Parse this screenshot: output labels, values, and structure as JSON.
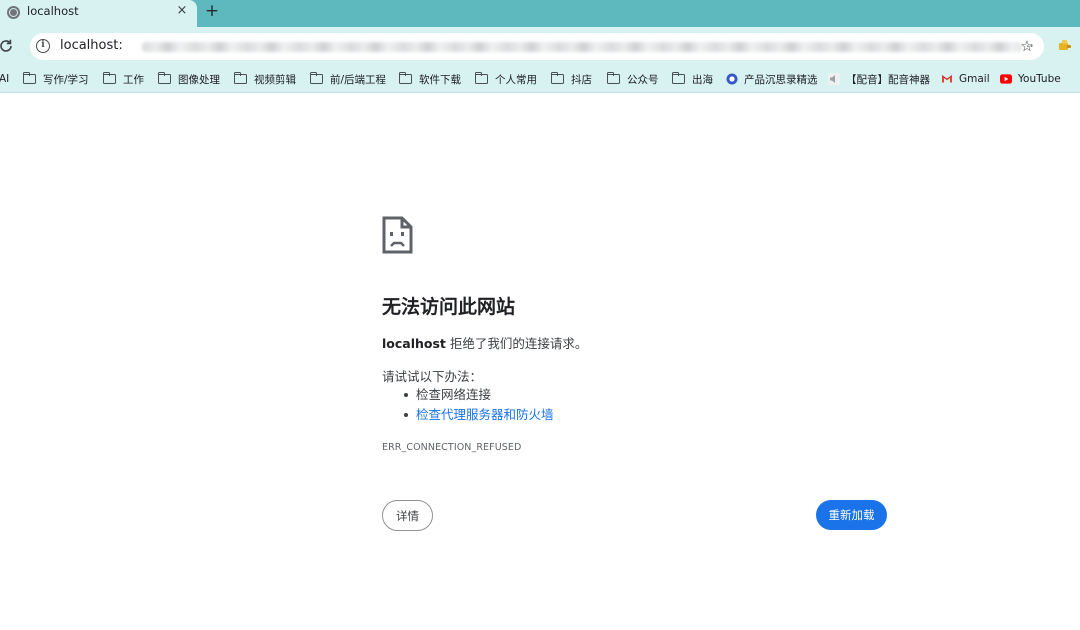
{
  "tab": {
    "title": "localhost",
    "close_glyph": "×",
    "new_tab_glyph": "+"
  },
  "toolbar": {
    "url": "localhost:",
    "url_ellipsis": "..",
    "star_glyph": "☆"
  },
  "bookmarks": {
    "first_item": "AI",
    "items": [
      {
        "label": "写作/学习",
        "icon": "folder-icon"
      },
      {
        "label": "工作",
        "icon": "folder-icon"
      },
      {
        "label": "图像处理",
        "icon": "folder-icon"
      },
      {
        "label": "视频剪辑",
        "icon": "folder-icon"
      },
      {
        "label": "前/后端工程",
        "icon": "folder-icon"
      },
      {
        "label": "软件下载",
        "icon": "folder-icon"
      },
      {
        "label": "个人常用",
        "icon": "folder-icon"
      },
      {
        "label": "抖店",
        "icon": "folder-icon"
      },
      {
        "label": "公众号",
        "icon": "folder-icon"
      },
      {
        "label": "出海",
        "icon": "folder-icon"
      },
      {
        "label": "产品沉思录精选",
        "icon": "circle-logo-icon"
      },
      {
        "label": "【配音】配音神器",
        "icon": "speaker-icon"
      },
      {
        "label": "Gmail",
        "icon": "gmail-icon"
      },
      {
        "label": "YouTube",
        "icon": "youtube-icon"
      }
    ]
  },
  "error": {
    "heading": "无法访问此网站",
    "host": "localhost",
    "description": " 拒绝了我们的连接请求。",
    "try_label": "请试试以下办法：",
    "suggestions": [
      "检查网络连接",
      "检查代理服务器和防火墙"
    ],
    "code": "ERR_CONNECTION_REFUSED",
    "details_label": "详情",
    "reload_label": "重新加载"
  },
  "colors": {
    "tab_strip": "#5eb9be",
    "toolbar": "#d8f1f1",
    "link": "#1a73e8",
    "primary_button": "#1a73e8"
  }
}
